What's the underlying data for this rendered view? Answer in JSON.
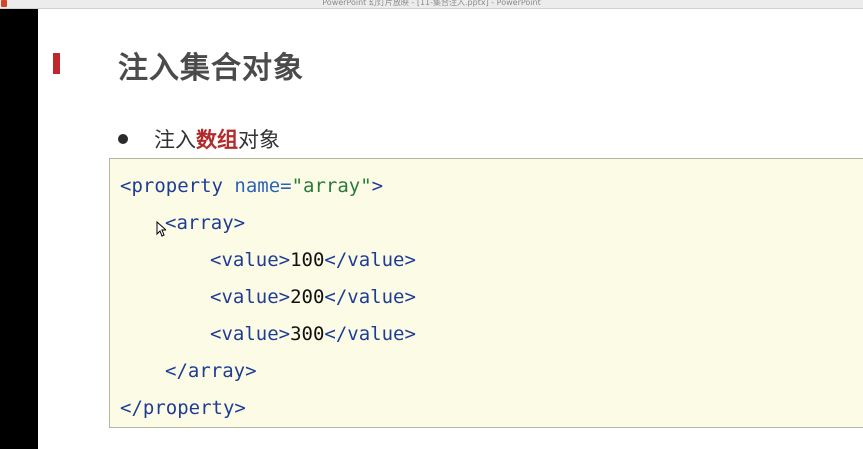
{
  "window": {
    "title": "PowerPoint 幻灯片放映 - [11-集合注入.pptx] - PowerPoint"
  },
  "slide": {
    "title": "注入集合对象",
    "bullet": {
      "prefix": "注入",
      "emphasis": "数组",
      "suffix": "对象"
    },
    "code": {
      "line1": {
        "open": "<property",
        "attr": " name=",
        "value": "\"array\"",
        "close": ">"
      },
      "line2": "<array>",
      "line3": {
        "open": "<value>",
        "text": "100",
        "close": "</value>"
      },
      "line4": {
        "open": "<value>",
        "text": "200",
        "close": "</value>"
      },
      "line5": {
        "open": "<value>",
        "text": "300",
        "close": "</value>"
      },
      "line6": "</array>",
      "line7": "</property>"
    }
  },
  "colors": {
    "accent": "#c0262d",
    "emphasis": "#b22a2a",
    "code_background": "#fcfce6",
    "tag": "#1f3c94",
    "attribute": "#2c63b8",
    "string": "#2a7b3b"
  },
  "icons": {
    "app": "powerpoint-icon",
    "pointer": "mouse-pointer-icon"
  }
}
